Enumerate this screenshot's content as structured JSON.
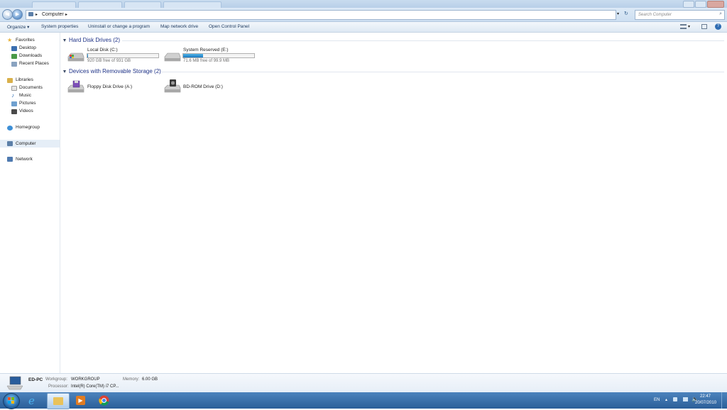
{
  "address": {
    "location": "Computer",
    "search_placeholder": "Search Computer"
  },
  "toolbar": {
    "organize": "Organize ▾",
    "system_properties": "System properties",
    "uninstall": "Uninstall or change a program",
    "map_drive": "Map network drive",
    "control_panel": "Open Control Panel"
  },
  "sidebar": {
    "favorites": "Favorites",
    "desktop": "Desktop",
    "downloads": "Downloads",
    "recent": "Recent Places",
    "libraries": "Libraries",
    "documents": "Documents",
    "music": "Music",
    "pictures": "Pictures",
    "videos": "Videos",
    "homegroup": "Homegroup",
    "computer": "Computer",
    "network": "Network"
  },
  "groups": {
    "hdd": "Hard Disk Drives (2)",
    "removable": "Devices with Removable Storage (2)"
  },
  "drives": {
    "c": {
      "label": "Local Disk (C:)",
      "free": "920 GB free of 931 GB",
      "used_fraction": 0.012
    },
    "e": {
      "label": "System Reserved (E:)",
      "free": "71.6 MB free of 99.9 MB",
      "used_fraction": 0.28
    },
    "a": {
      "label": "Floppy Disk Drive (A:)"
    },
    "d": {
      "label": "BD-ROM Drive (D:)"
    }
  },
  "details": {
    "name": "ED-PC",
    "workgroup_label": "Workgroup:",
    "workgroup": "WORKGROUP",
    "memory_label": "Memory:",
    "memory": "6.00 GB",
    "processor_label": "Processor:",
    "processor": "Intel(R) Core(TM) i7 CP..."
  },
  "tray": {
    "lang": "EN",
    "time": "22:47",
    "date": "20/07/2010"
  },
  "colors": {
    "accent": "#1e3287",
    "taskbar": "#2b5f99"
  }
}
